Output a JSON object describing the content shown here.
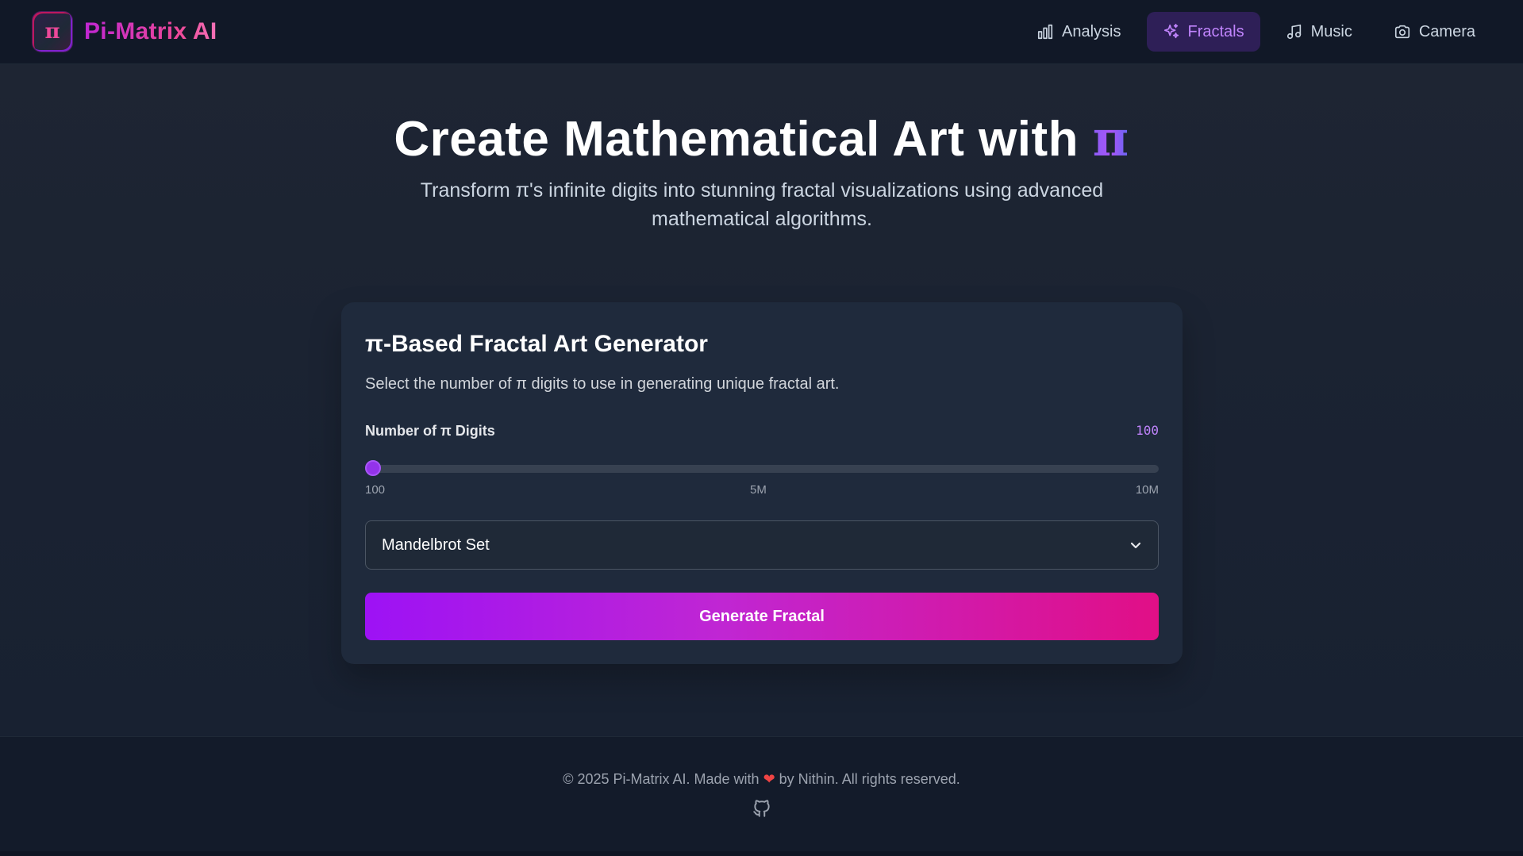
{
  "header": {
    "logo_glyph": "π",
    "brand": "Pi-Matrix AI",
    "nav": [
      {
        "label": "Analysis",
        "icon": "bar-chart-icon",
        "active": false
      },
      {
        "label": "Fractals",
        "icon": "sparkles-icon",
        "active": true
      },
      {
        "label": "Music",
        "icon": "music-note-icon",
        "active": false
      },
      {
        "label": "Camera",
        "icon": "camera-icon",
        "active": false
      }
    ]
  },
  "hero": {
    "title_prefix": "Create Mathematical Art with ",
    "title_pi": "π",
    "subtitle": "Transform π's infinite digits into stunning fractal visualizations using advanced mathematical algorithms."
  },
  "generator": {
    "title": "π-Based Fractal Art Generator",
    "description": "Select the number of π digits to use in generating unique fractal art.",
    "digits_label": "Number of π Digits",
    "digits_value": "100",
    "slider": {
      "value_fraction": 0.0,
      "ticks": [
        "100",
        "5M",
        "10M"
      ]
    },
    "fractal_type": "Mandelbrot Set",
    "generate_label": "Generate Fractal"
  },
  "footer": {
    "text_before": "© 2025 Pi-Matrix AI. Made with ",
    "heart": "❤",
    "text_after": " by Nithin. All rights reserved.",
    "github_icon": "github-icon"
  },
  "colors": {
    "accent_purple": "#9333ea",
    "accent_pink": "#e10f86",
    "background": "#161e2e",
    "card": "#1f2a3c"
  }
}
